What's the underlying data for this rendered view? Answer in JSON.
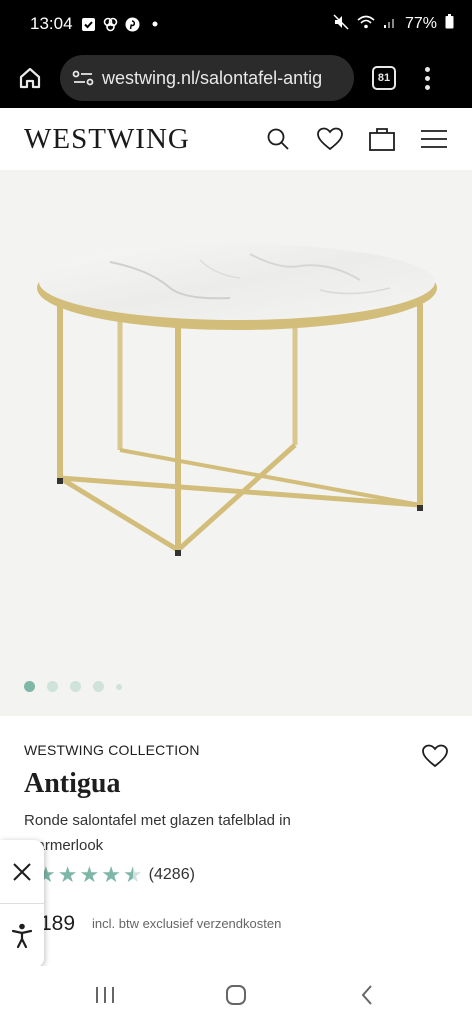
{
  "status_bar": {
    "time": "13:04",
    "battery": "77%"
  },
  "browser": {
    "url": "westwing.nl/salontafel-antig",
    "tab_count": "81"
  },
  "site": {
    "logo": "WESTWING",
    "icons": [
      "search-icon",
      "heart-icon",
      "bag-icon",
      "hamburger-icon"
    ]
  },
  "gallery": {
    "image_count": 5,
    "active_index": 0
  },
  "product": {
    "brand": "WESTWING COLLECTION",
    "name": "Antigua",
    "description": "Ronde salontafel met glazen tafelblad in marmerlook",
    "rating": 4.5,
    "review_count": "(4286)",
    "price": "189",
    "tax_note": "incl. btw exclusief verzendkosten"
  },
  "colors": {
    "accent": "#7eb6a8",
    "gold": "#d3bd7b"
  }
}
